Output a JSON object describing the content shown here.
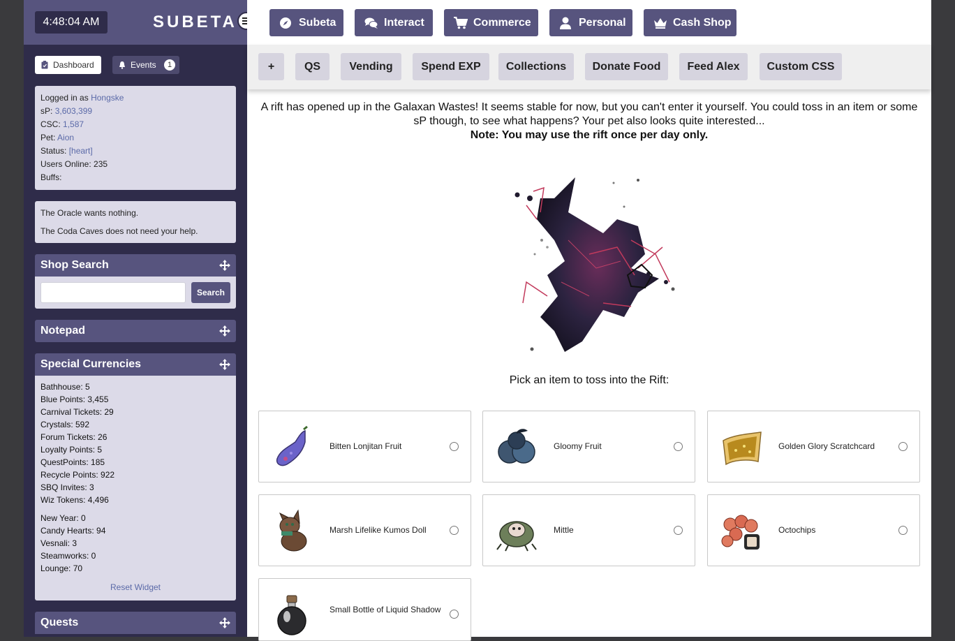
{
  "header": {
    "clock": "4:48:04 AM",
    "logo": "SUBETA",
    "nav": [
      {
        "label": "Subeta",
        "icon": "compass-icon"
      },
      {
        "label": "Interact",
        "icon": "chat-icon"
      },
      {
        "label": "Commerce",
        "icon": "cart-icon"
      },
      {
        "label": "Personal",
        "icon": "user-icon"
      },
      {
        "label": "Cash Shop",
        "icon": "crown-icon"
      }
    ],
    "subnav": [
      "+",
      "QS",
      "Vending",
      "Spend EXP",
      "Collections",
      "Donate Food",
      "Feed Alex",
      "Custom CSS"
    ]
  },
  "sidebar": {
    "dashboard_label": "Dashboard",
    "events_label": "Events",
    "events_count": "1",
    "user": {
      "logged_in_prefix": "Logged in as",
      "username": "Hongske",
      "sp_label": "sP:",
      "sp": "3,603,399",
      "csc_label": "CSC:",
      "csc": "1,587",
      "pet_label": "Pet:",
      "pet": "Aion",
      "status_label": "Status:",
      "status": "[heart]",
      "users_online": "Users Online: 235",
      "buffs": "Buffs:"
    },
    "oracle": [
      "The Oracle wants nothing.",
      "The Coda Caves does not need your help."
    ],
    "shop_search": {
      "title": "Shop Search",
      "button": "Search",
      "value": ""
    },
    "notepad_title": "Notepad",
    "currencies": {
      "title": "Special Currencies",
      "group1": [
        "Bathhouse: 5",
        "Blue Points: 3,455",
        "Carnival Tickets: 29",
        "Crystals: 592",
        "Forum Tickets: 26",
        "Loyalty Points: 5",
        "QuestPoints: 185",
        "Recycle Points: 922",
        "SBQ Invites: 3",
        "Wiz Tokens: 4,496"
      ],
      "group2": [
        "New Year: 0",
        "Candy Hearts: 94",
        "Vesnali: 3",
        "Steamworks: 0",
        "Lounge: 70"
      ],
      "reset": "Reset Widget"
    },
    "quests_title": "Quests"
  },
  "main": {
    "intro": "A rift has opened up in the Galaxan Wastes! It seems stable for now, but you can't enter it yourself. You could toss in an item or some sP though, to see what happens? Your pet also looks quite interested...",
    "note": "Note: You may use the rift once per day only.",
    "pick": "Pick an item to toss into the Rift:",
    "items": [
      {
        "name": "Bitten Lonjitan Fruit"
      },
      {
        "name": "Gloomy Fruit"
      },
      {
        "name": "Golden Glory Scratchcard"
      },
      {
        "name": "Marsh Lifelike Kumos Doll"
      },
      {
        "name": "Mittle"
      },
      {
        "name": "Octochips"
      },
      {
        "name": "Small Bottle of Liquid Shadow"
      }
    ]
  },
  "colors": {
    "accent": "#57547e",
    "sidebar": "#2f2c4a",
    "panel": "#dcdae8",
    "link": "#5b6aa8"
  }
}
